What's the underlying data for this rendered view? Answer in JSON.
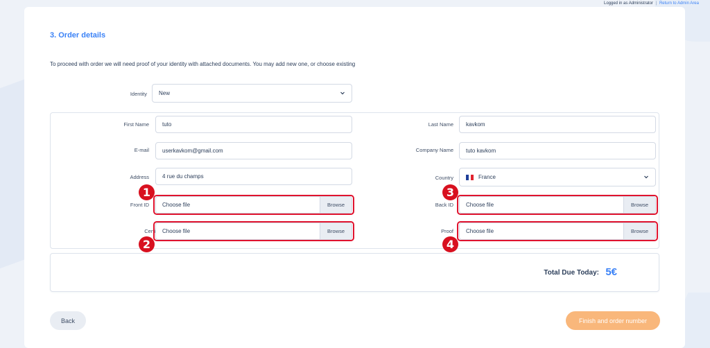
{
  "topbar": {
    "logged_in": "Logged in as Administrator",
    "separator": "|",
    "return_link": "Return to Admin Area"
  },
  "section": {
    "title": "3. Order details",
    "intro": "To proceed with order we will need proof of your identity with attached documents. You may add new one, or choose existing"
  },
  "identity": {
    "label": "Identity",
    "value": "New"
  },
  "form": {
    "first_name": {
      "label": "First Name",
      "value": "tuto"
    },
    "last_name": {
      "label": "Last Name",
      "value": "kavkom"
    },
    "email": {
      "label": "E-mail",
      "value": "userkavkom@gmail.com"
    },
    "company": {
      "label": "Company Name",
      "value": "tuto kavkom"
    },
    "address": {
      "label": "Address",
      "value": "4 rue du champs"
    },
    "country": {
      "label": "Country",
      "value": "France",
      "flag_icon": "france-flag-icon"
    },
    "front_id": {
      "label": "Front ID",
      "placeholder": "Choose file",
      "browse": "Browse"
    },
    "back_id": {
      "label": "Back ID",
      "placeholder": "Choose file",
      "browse": "Browse"
    },
    "certificate": {
      "label": "Certificate",
      "placeholder": "Choose file",
      "browse": "Browse"
    },
    "proof": {
      "label": "Proof",
      "placeholder": "Choose file",
      "browse": "Browse"
    }
  },
  "annotations": {
    "badge1": "1",
    "badge2": "2",
    "badge3": "3",
    "badge4": "4",
    "highlight_color": "#e0132e"
  },
  "total": {
    "label": "Total Due Today:",
    "value": "5€"
  },
  "buttons": {
    "back": "Back",
    "finish": "Finish and order number"
  },
  "colors": {
    "accent": "#3b82f6",
    "finish_button": "#f9b77b",
    "badge": "#d8101f"
  }
}
